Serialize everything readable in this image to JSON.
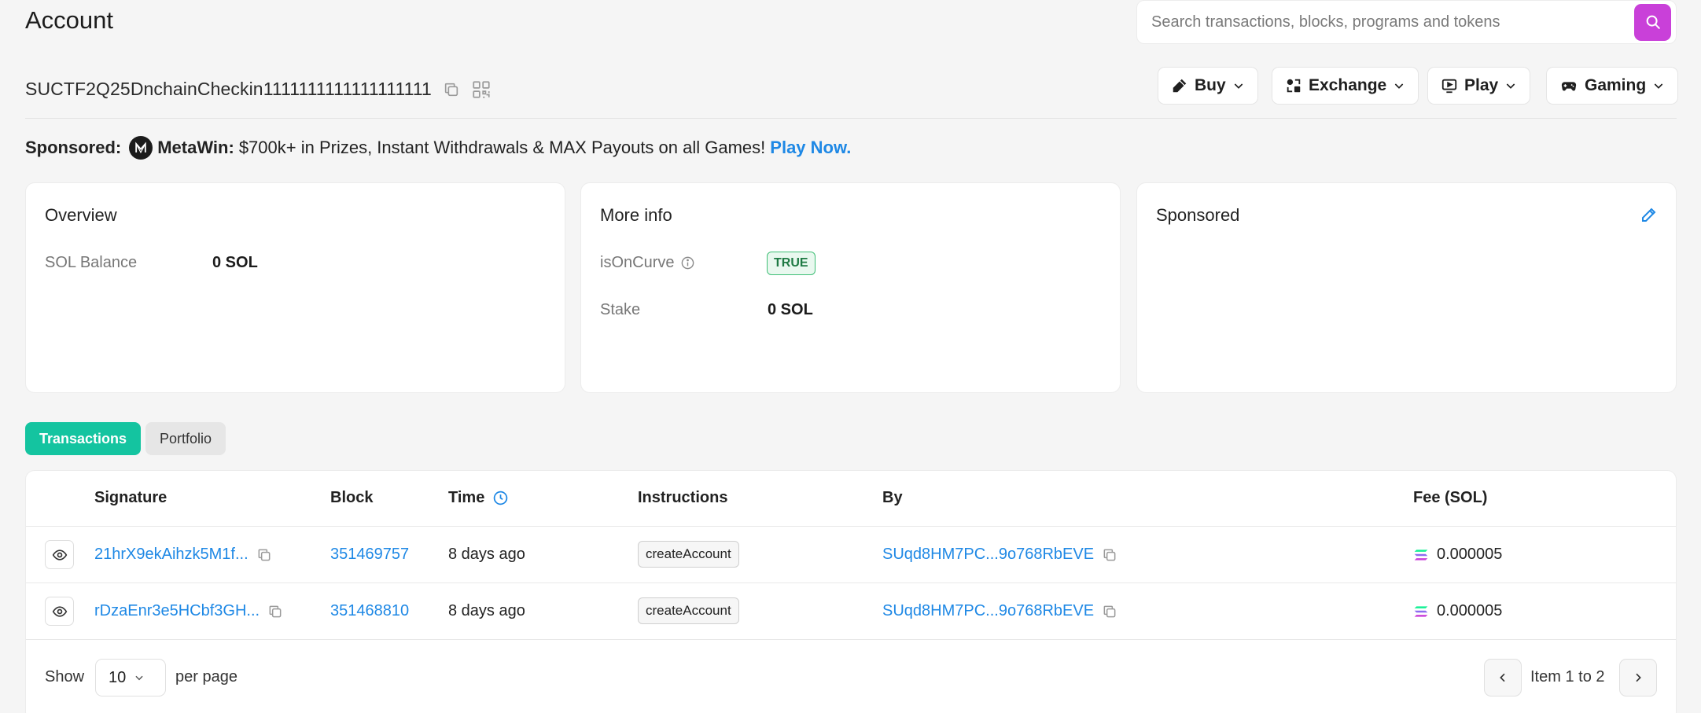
{
  "header": {
    "title": "Account",
    "search_placeholder": "Search transactions, blocks, programs and tokens"
  },
  "address": "SUCTF2Q25DnchainCheckin1111111111111111111",
  "nav": [
    {
      "label": "Buy",
      "icon": "buy-icon"
    },
    {
      "label": "Exchange",
      "icon": "exchange-icon"
    },
    {
      "label": "Play",
      "icon": "play-icon"
    },
    {
      "label": "Gaming",
      "icon": "gamepad-icon"
    }
  ],
  "sponsor": {
    "label": "Sponsored:",
    "brand": "MetaWin:",
    "text": "$700k+ in Prizes, Instant Withdrawals & MAX Payouts on all Games!",
    "cta": "Play Now."
  },
  "overview": {
    "title": "Overview",
    "balance_label": "SOL Balance",
    "balance_value": "0 SOL"
  },
  "more_info": {
    "title": "More info",
    "curve_label": "isOnCurve",
    "curve_value": "TRUE",
    "stake_label": "Stake",
    "stake_value": "0 SOL"
  },
  "sponsored_card": {
    "title": "Sponsored"
  },
  "tabs": {
    "transactions": "Transactions",
    "portfolio": "Portfolio"
  },
  "table": {
    "columns": {
      "signature": "Signature",
      "block": "Block",
      "time": "Time",
      "instructions": "Instructions",
      "by": "By",
      "fee": "Fee (SOL)"
    },
    "rows": [
      {
        "signature": "21hrX9ekAihzk5M1f...",
        "block": "351469757",
        "time": "8 days ago",
        "instruction": "createAccount",
        "by": "SUqd8HM7PC...9o768RbEVE",
        "fee": "0.000005"
      },
      {
        "signature": "rDzaEnr3e5HCbf3GH...",
        "block": "351468810",
        "time": "8 days ago",
        "instruction": "createAccount",
        "by": "SUqd8HM7PC...9o768RbEVE",
        "fee": "0.000005"
      }
    ]
  },
  "pagination": {
    "show_label": "Show",
    "page_size": "10",
    "per_page_label": "per page",
    "info": "Item 1 to 2"
  },
  "colors": {
    "accent_purple": "#c940d9",
    "tab_active": "#14c4a0",
    "link": "#1e88e5",
    "true_badge": "#3fbf76"
  }
}
